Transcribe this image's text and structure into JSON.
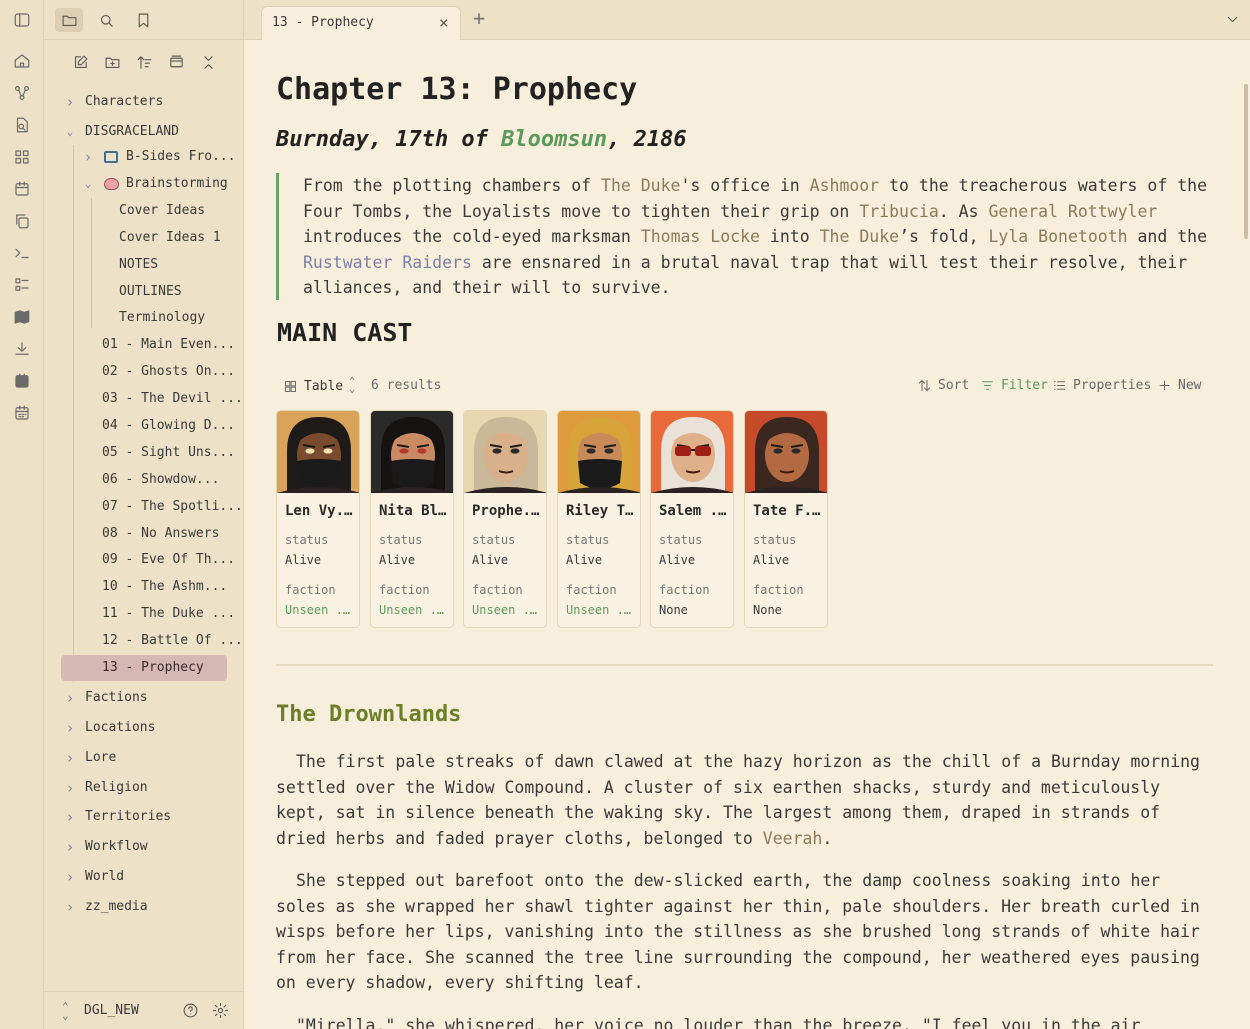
{
  "ribbon": {
    "icons": [
      "home-icon",
      "graph-icon",
      "file-search-icon",
      "blocks-icon",
      "calendar-icon",
      "copy-icon",
      "terminal-icon",
      "list-checks-icon",
      "map-icon",
      "download-icon",
      "calendar-check-icon",
      "calendar-grid-icon"
    ]
  },
  "sidebar": {
    "tree": [
      {
        "label": "Characters",
        "collapsed": true
      },
      {
        "label": "DISGRACELAND",
        "expanded": true
      },
      {
        "label": "B-Sides Fro...",
        "icon": "canvas-icon"
      },
      {
        "label": "Brainstorming",
        "icon": "brain-icon",
        "expanded": true
      },
      {
        "label": "Cover Ideas"
      },
      {
        "label": "Cover Ideas 1"
      },
      {
        "label": "NOTES"
      },
      {
        "label": "OUTLINES"
      },
      {
        "label": "Terminology"
      },
      {
        "label": "01 - Main Even..."
      },
      {
        "label": "02 - Ghosts On..."
      },
      {
        "label": "03 - The Devil ..."
      },
      {
        "label": "04 - Glowing D..."
      },
      {
        "label": "05 - Sight Uns..."
      },
      {
        "label": "06 - Showdow..."
      },
      {
        "label": "07 - The Spotli..."
      },
      {
        "label": "08 - No Answers"
      },
      {
        "label": "09 - Eve Of Th..."
      },
      {
        "label": "10 - The Ashm..."
      },
      {
        "label": "11 - The Duke ..."
      },
      {
        "label": "12 - Battle Of ..."
      },
      {
        "label": "13 - Prophecy",
        "selected": true
      },
      {
        "label": "Factions"
      },
      {
        "label": "Locations"
      },
      {
        "label": "Lore"
      },
      {
        "label": "Religion"
      },
      {
        "label": "Territories"
      },
      {
        "label": "Workflow"
      },
      {
        "label": "World"
      },
      {
        "label": "zz_media"
      }
    ],
    "vault_name": "DGL_NEW"
  },
  "tab": {
    "title": "13 - Prophecy"
  },
  "note": {
    "title": "Chapter 13: Prophecy",
    "date_prefix": "Burnday, 17th of ",
    "date_link": "Bloomsun",
    "date_suffix": ", 2186",
    "quote": {
      "t1": "From the plotting chambers of ",
      "l1": "The Duke",
      "t2": "'s office in ",
      "l2": "Ashmoor",
      "t3": " to the treacherous waters of the Four Tombs, the Loyalists move to tighten their grip on ",
      "l3": "Tribucia",
      "t4": ". As ",
      "l4": "General Rottwyler",
      "t5": " introduces the cold-eyed marksman ",
      "l5": "Thomas Locke",
      "t6": " into ",
      "l6": "The Duke",
      "t7": "’s fold, ",
      "l7": "Lyla Bonetooth",
      "t8": " and the ",
      "l8": "Rustwater Raiders",
      "t9": " are ensnared in a brutal naval trap that will test their resolve, their alliances, and their will to survive."
    },
    "cast_heading": "MAIN CAST",
    "base": {
      "view": "Table",
      "results": "6 results",
      "sort": "Sort",
      "filter": "Filter",
      "properties": "Properties",
      "new": "New",
      "status_key": "status",
      "faction_key": "faction",
      "cards": [
        {
          "name": "Len Vy...",
          "status": "Alive",
          "faction": "Unseen ...",
          "faction_link": true
        },
        {
          "name": "Nita Bl...",
          "status": "Alive",
          "faction": "Unseen ...",
          "faction_link": true
        },
        {
          "name": "Prophe...",
          "status": "Alive",
          "faction": "Unseen ...",
          "faction_link": true
        },
        {
          "name": "Riley T...",
          "status": "Alive",
          "faction": "Unseen ...",
          "faction_link": true
        },
        {
          "name": "Salem ...",
          "status": "Alive",
          "faction": "None",
          "faction_link": false
        },
        {
          "name": "Tate F...",
          "status": "Alive",
          "faction": "None",
          "faction_link": false
        }
      ]
    },
    "section_heading": "The Drownlands",
    "p1_a": "The first pale streaks of dawn clawed at the hazy horizon as the chill of a Burnday morning settled over the Widow Compound. A cluster of six earthen shacks, sturdy and meticulously kept, sat in silence beneath the waking sky. The largest among them, draped in strands of dried herbs and faded prayer cloths, belonged to ",
    "p1_link": "Veerah",
    "p1_b": ".",
    "p2": "She stepped out barefoot onto the dew-slicked earth, the damp coolness soaking into her soles as she wrapped her shawl tighter against her thin, pale shoulders. Her breath curled in wisps before her lips, vanishing into the stillness as she brushed long strands of white hair from her face. She scanned the tree line surrounding the compound, her weathered eyes pausing on every shadow, every shifting leaf.",
    "p3": "\"Mirella,\" she whispered, her voice no louder than the breeze. \"I feel you in the air today.\""
  },
  "colors": {
    "background": "#f7eedb",
    "sidebar": "#ede1c7",
    "link_green": "#5b9a5a",
    "heading_olive": "#6b7f28",
    "selected": "#d5b8b3"
  }
}
